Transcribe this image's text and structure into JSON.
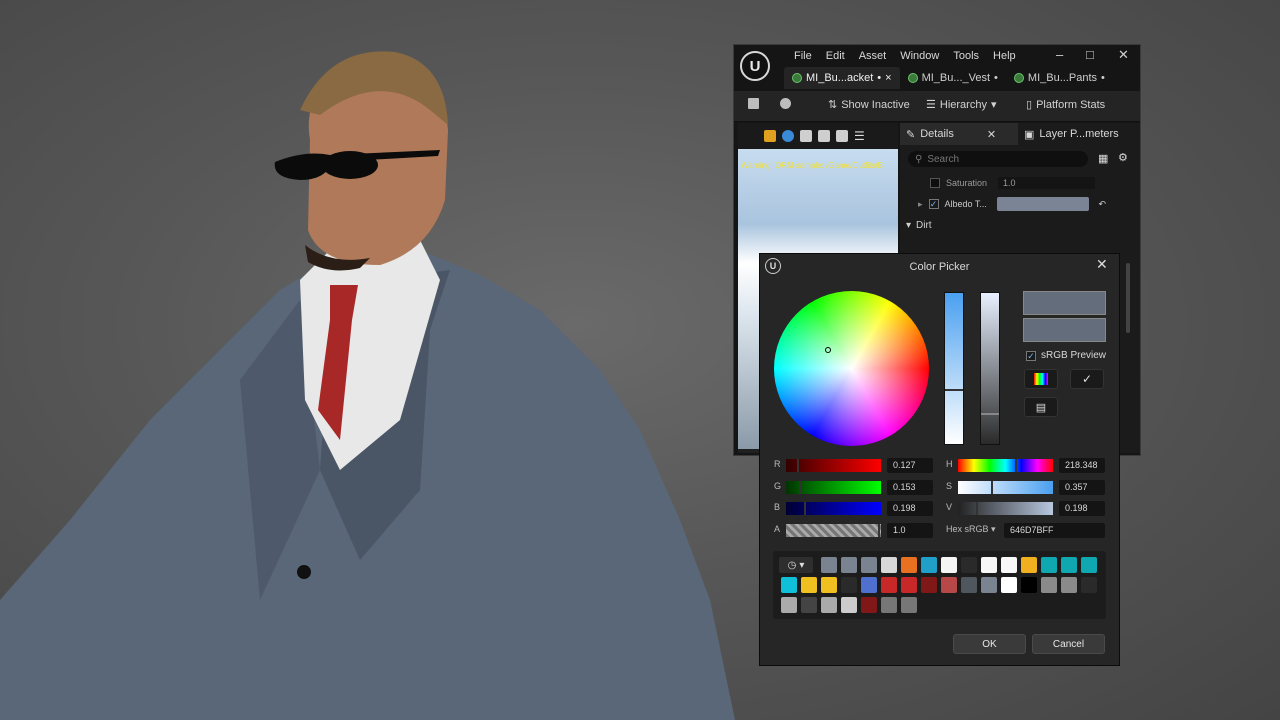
{
  "editor": {
    "menu": [
      "File",
      "Edit",
      "Asset",
      "Window",
      "Tools",
      "Help"
    ],
    "tabs": [
      {
        "label": "MI_Bu...acket",
        "dirty": "•",
        "close": "×"
      },
      {
        "label": "MI_Bu..._Vest",
        "dirty": "•"
      },
      {
        "label": "MI_Bu...Pants",
        "dirty": "•"
      }
    ],
    "toolbar": {
      "show_inactive": "Show Inactive",
      "hierarchy": "Hierarchy",
      "platform_stats": "Platform Stats"
    },
    "viewport": {
      "warning": "Warning: ORM sample: /Game/Outfits/B"
    },
    "details": {
      "tab_details": "Details",
      "tab_layers": "Layer P...meters",
      "search_placeholder": "Search",
      "props": [
        {
          "label": "Saturation",
          "value": "1.0"
        },
        {
          "label": "Albedo T...",
          "checked": true
        }
      ],
      "section": "Dirt"
    }
  },
  "color_picker": {
    "title": "Color Picker",
    "srgb_preview": "sRGB Preview",
    "srgb_checked": true,
    "current_color": "#646D7B",
    "channels": {
      "R": {
        "label": "R",
        "value": "0.127"
      },
      "G": {
        "label": "G",
        "value": "0.153"
      },
      "B": {
        "label": "B",
        "value": "0.198"
      },
      "A": {
        "label": "A",
        "value": "1.0"
      },
      "H": {
        "label": "H",
        "value": "218.348"
      },
      "S": {
        "label": "S",
        "value": "0.357"
      },
      "V": {
        "label": "V",
        "value": "0.198"
      }
    },
    "hex_label": "Hex sRGB",
    "hex_value": "646D7BFF",
    "theme_swatches": [
      "#7a8390",
      "#7a8390",
      "#7a8390",
      "#d8d8d8",
      "#e87020",
      "#20a0c8",
      "#f4f4f4",
      "#2a2a2a",
      "#f8f8f8",
      "#f8f8f8",
      "#f0b020",
      "#10a8b0",
      "#10a8b0",
      "#10a8b0",
      "#10c0d8",
      "#f0c020",
      "#f0c020",
      "#2a2a2a",
      "#5070d0",
      "#c82828",
      "#c82828",
      "#801818",
      "#b84848",
      "#50565e",
      "#7a8390",
      "#ffffff",
      "#000000",
      "#8a8a8a",
      "#8a8a8a",
      "#2a2a2a",
      "#aaaaaa",
      "#444444",
      "#aaaaaa",
      "#cccccc",
      "#801818",
      "#777777",
      "#777777"
    ],
    "ok": "OK",
    "cancel": "Cancel"
  }
}
